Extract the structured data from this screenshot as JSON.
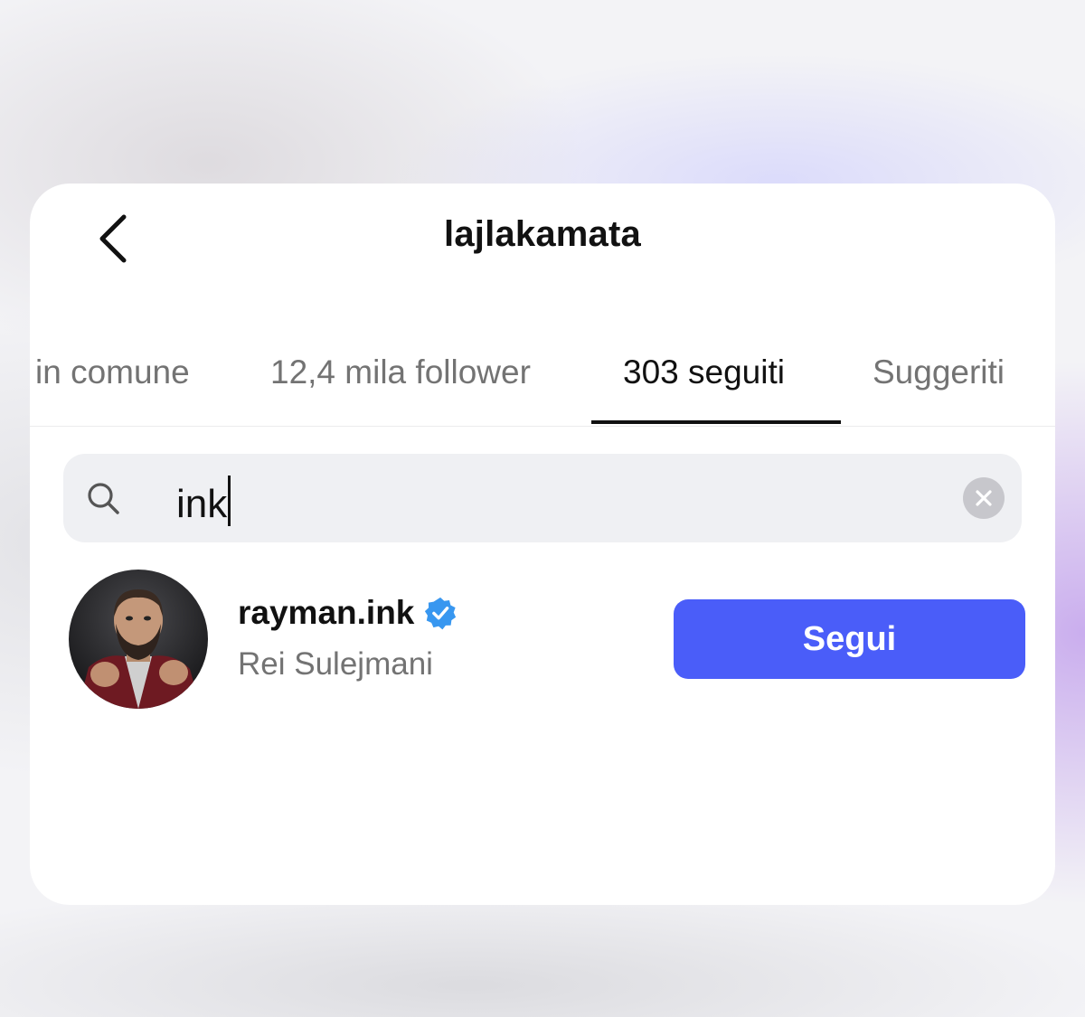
{
  "header": {
    "title": "lajlakamata",
    "back_icon": "chevron-left-icon"
  },
  "tabs": [
    {
      "label": "in comune",
      "active": false
    },
    {
      "label": "12,4 mila follower",
      "active": false
    },
    {
      "label": "303 seguiti",
      "active": true
    },
    {
      "label": "Suggeriti",
      "active": false
    }
  ],
  "search": {
    "value": "ink",
    "icon": "search-icon",
    "clear_icon": "clear-icon"
  },
  "results": [
    {
      "username": "rayman.ink",
      "verified": true,
      "full_name": "Rei Sulejmani",
      "follow_label": "Segui"
    }
  ],
  "colors": {
    "accent": "#4a5df9",
    "verified": "#3897f0",
    "secondary_text": "#737373",
    "search_bg": "#eff0f3"
  }
}
